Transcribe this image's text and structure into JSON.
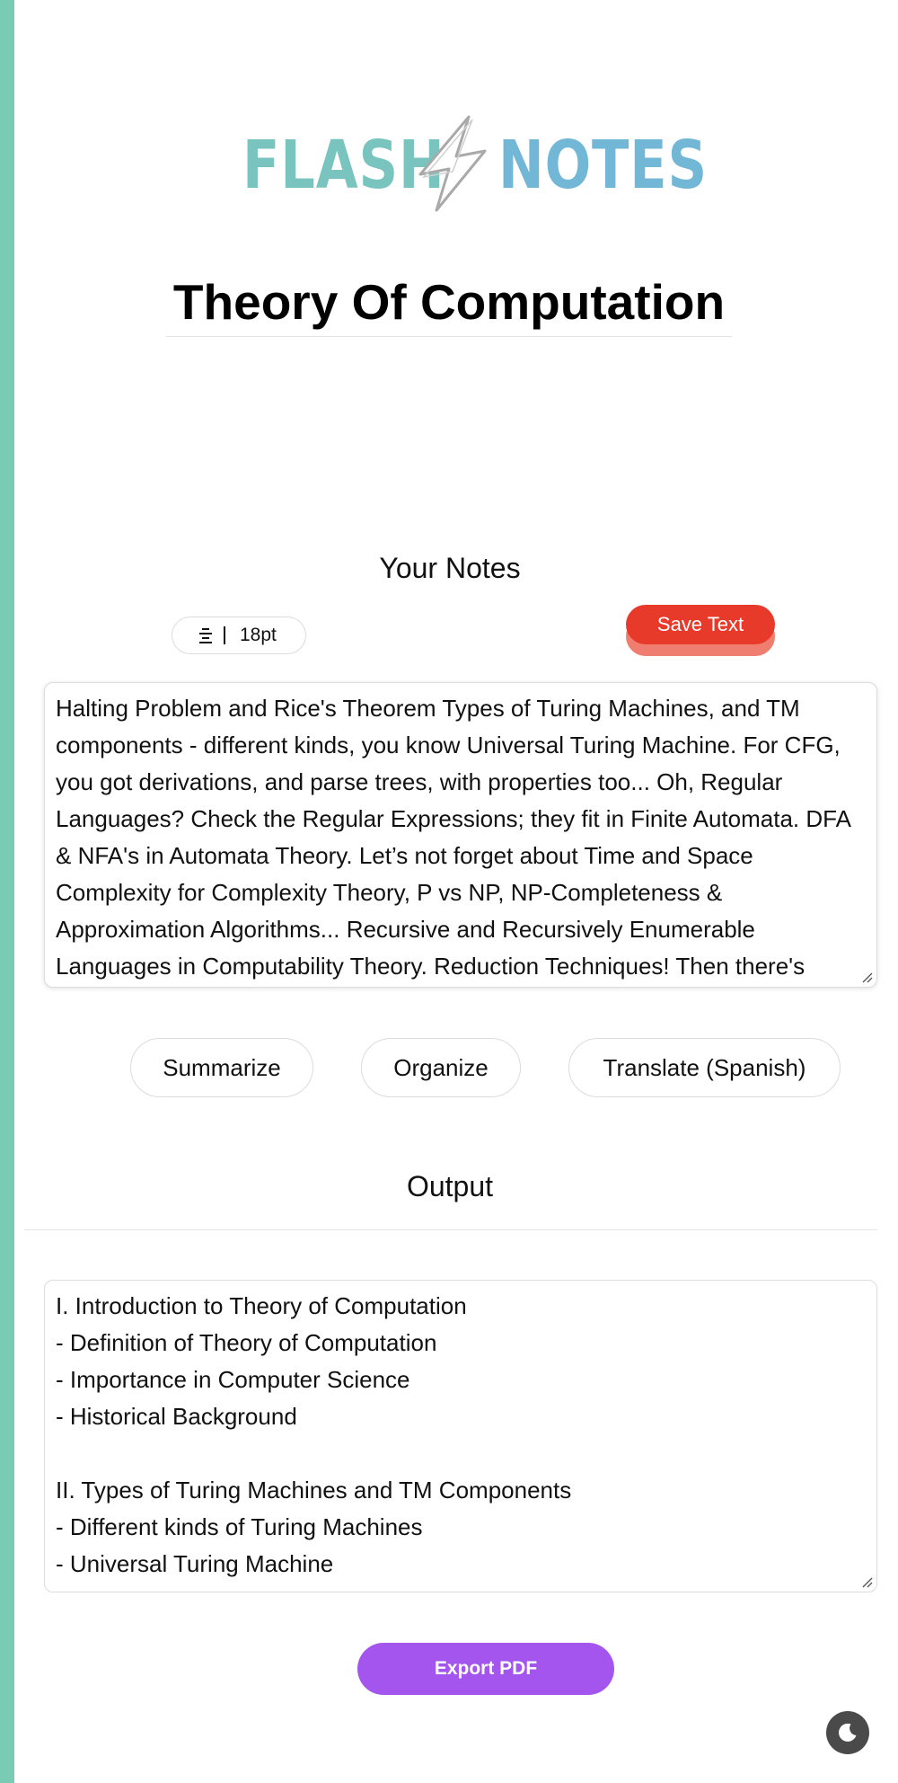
{
  "logo": {
    "word_left": "FLASH",
    "word_right": "NOTES",
    "color_left": "#79c4bf",
    "color_right": "#72b8d6"
  },
  "page": {
    "title": "Theory Of Computation",
    "accent_stripe_color": "#79ccb3"
  },
  "notes": {
    "heading": "Your Notes",
    "font_size_label": "18pt",
    "align_icon": "align-center-icon",
    "save_label": "Save Text",
    "save_color": "#e83a2a",
    "text": "Halting Problem and Rice's Theorem Types of Turing Machines, and TM components - different kinds, you know Universal Turing Machine. For CFG, you got derivations, and parse trees, with properties too... Oh, Regular Languages? Check the Regular Expressions; they fit in Finite Automata. DFA & NFA's in Automata Theory. Let’s not forget about Time and Space Complexity for Complexity Theory, P vs NP, NP-Completeness & Approximation Algorithms... Recursive and Recursively Enumerable Languages in Computability Theory. Reduction Techniques! Then there's"
  },
  "actions": {
    "summarize": "Summarize",
    "organize": "Organize",
    "translate": "Translate (Spanish)"
  },
  "output": {
    "heading": "Output",
    "lines": [
      "I. Introduction to Theory of Computation",
      "- Definition of Theory of Computation",
      "- Importance in Computer Science",
      "- Historical Background",
      "",
      "II. Types of Turing Machines and TM Components",
      "- Different kinds of Turing Machines",
      "- Universal Turing Machine"
    ]
  },
  "export": {
    "label": "Export PDF",
    "color": "#a455ee"
  },
  "theme_toggle": {
    "icon": "moon-icon"
  }
}
